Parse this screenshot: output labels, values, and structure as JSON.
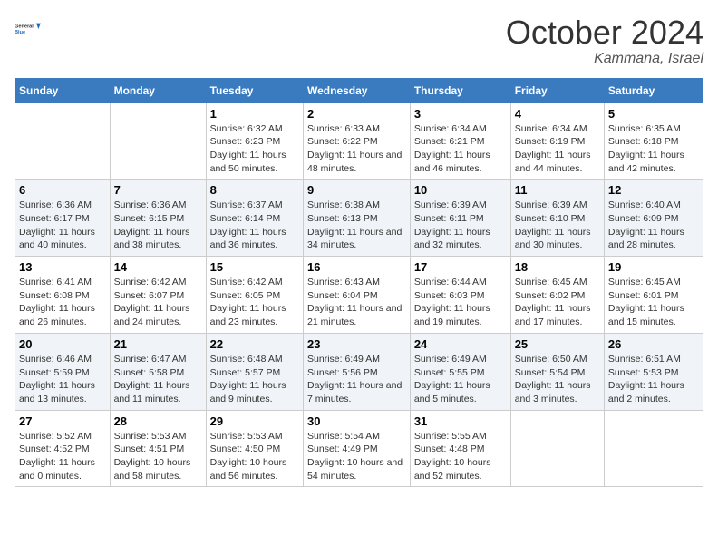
{
  "header": {
    "logo_line1": "General",
    "logo_line2": "Blue",
    "month": "October 2024",
    "location": "Kammana, Israel"
  },
  "days_of_week": [
    "Sunday",
    "Monday",
    "Tuesday",
    "Wednesday",
    "Thursday",
    "Friday",
    "Saturday"
  ],
  "weeks": [
    [
      {
        "day": "",
        "info": ""
      },
      {
        "day": "",
        "info": ""
      },
      {
        "day": "1",
        "info": "Sunrise: 6:32 AM\nSunset: 6:23 PM\nDaylight: 11 hours and 50 minutes."
      },
      {
        "day": "2",
        "info": "Sunrise: 6:33 AM\nSunset: 6:22 PM\nDaylight: 11 hours and 48 minutes."
      },
      {
        "day": "3",
        "info": "Sunrise: 6:34 AM\nSunset: 6:21 PM\nDaylight: 11 hours and 46 minutes."
      },
      {
        "day": "4",
        "info": "Sunrise: 6:34 AM\nSunset: 6:19 PM\nDaylight: 11 hours and 44 minutes."
      },
      {
        "day": "5",
        "info": "Sunrise: 6:35 AM\nSunset: 6:18 PM\nDaylight: 11 hours and 42 minutes."
      }
    ],
    [
      {
        "day": "6",
        "info": "Sunrise: 6:36 AM\nSunset: 6:17 PM\nDaylight: 11 hours and 40 minutes."
      },
      {
        "day": "7",
        "info": "Sunrise: 6:36 AM\nSunset: 6:15 PM\nDaylight: 11 hours and 38 minutes."
      },
      {
        "day": "8",
        "info": "Sunrise: 6:37 AM\nSunset: 6:14 PM\nDaylight: 11 hours and 36 minutes."
      },
      {
        "day": "9",
        "info": "Sunrise: 6:38 AM\nSunset: 6:13 PM\nDaylight: 11 hours and 34 minutes."
      },
      {
        "day": "10",
        "info": "Sunrise: 6:39 AM\nSunset: 6:11 PM\nDaylight: 11 hours and 32 minutes."
      },
      {
        "day": "11",
        "info": "Sunrise: 6:39 AM\nSunset: 6:10 PM\nDaylight: 11 hours and 30 minutes."
      },
      {
        "day": "12",
        "info": "Sunrise: 6:40 AM\nSunset: 6:09 PM\nDaylight: 11 hours and 28 minutes."
      }
    ],
    [
      {
        "day": "13",
        "info": "Sunrise: 6:41 AM\nSunset: 6:08 PM\nDaylight: 11 hours and 26 minutes."
      },
      {
        "day": "14",
        "info": "Sunrise: 6:42 AM\nSunset: 6:07 PM\nDaylight: 11 hours and 24 minutes."
      },
      {
        "day": "15",
        "info": "Sunrise: 6:42 AM\nSunset: 6:05 PM\nDaylight: 11 hours and 23 minutes."
      },
      {
        "day": "16",
        "info": "Sunrise: 6:43 AM\nSunset: 6:04 PM\nDaylight: 11 hours and 21 minutes."
      },
      {
        "day": "17",
        "info": "Sunrise: 6:44 AM\nSunset: 6:03 PM\nDaylight: 11 hours and 19 minutes."
      },
      {
        "day": "18",
        "info": "Sunrise: 6:45 AM\nSunset: 6:02 PM\nDaylight: 11 hours and 17 minutes."
      },
      {
        "day": "19",
        "info": "Sunrise: 6:45 AM\nSunset: 6:01 PM\nDaylight: 11 hours and 15 minutes."
      }
    ],
    [
      {
        "day": "20",
        "info": "Sunrise: 6:46 AM\nSunset: 5:59 PM\nDaylight: 11 hours and 13 minutes."
      },
      {
        "day": "21",
        "info": "Sunrise: 6:47 AM\nSunset: 5:58 PM\nDaylight: 11 hours and 11 minutes."
      },
      {
        "day": "22",
        "info": "Sunrise: 6:48 AM\nSunset: 5:57 PM\nDaylight: 11 hours and 9 minutes."
      },
      {
        "day": "23",
        "info": "Sunrise: 6:49 AM\nSunset: 5:56 PM\nDaylight: 11 hours and 7 minutes."
      },
      {
        "day": "24",
        "info": "Sunrise: 6:49 AM\nSunset: 5:55 PM\nDaylight: 11 hours and 5 minutes."
      },
      {
        "day": "25",
        "info": "Sunrise: 6:50 AM\nSunset: 5:54 PM\nDaylight: 11 hours and 3 minutes."
      },
      {
        "day": "26",
        "info": "Sunrise: 6:51 AM\nSunset: 5:53 PM\nDaylight: 11 hours and 2 minutes."
      }
    ],
    [
      {
        "day": "27",
        "info": "Sunrise: 5:52 AM\nSunset: 4:52 PM\nDaylight: 11 hours and 0 minutes."
      },
      {
        "day": "28",
        "info": "Sunrise: 5:53 AM\nSunset: 4:51 PM\nDaylight: 10 hours and 58 minutes."
      },
      {
        "day": "29",
        "info": "Sunrise: 5:53 AM\nSunset: 4:50 PM\nDaylight: 10 hours and 56 minutes."
      },
      {
        "day": "30",
        "info": "Sunrise: 5:54 AM\nSunset: 4:49 PM\nDaylight: 10 hours and 54 minutes."
      },
      {
        "day": "31",
        "info": "Sunrise: 5:55 AM\nSunset: 4:48 PM\nDaylight: 10 hours and 52 minutes."
      },
      {
        "day": "",
        "info": ""
      },
      {
        "day": "",
        "info": ""
      }
    ]
  ]
}
